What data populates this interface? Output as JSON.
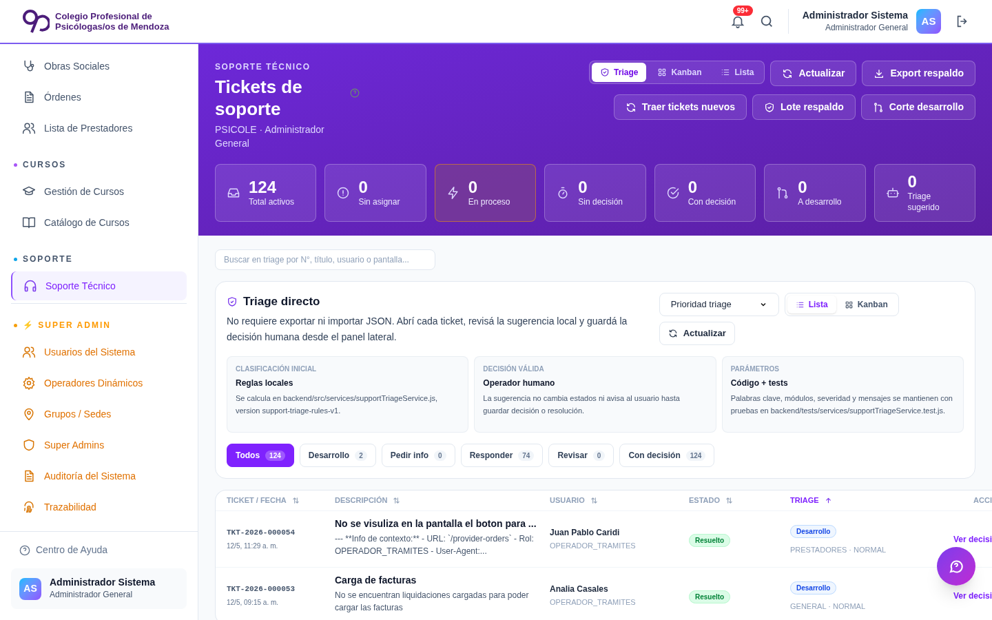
{
  "header": {
    "org_line_1": "Colegio Profesional de",
    "org_line_2": "Psicólogas/os de Mendoza",
    "notification_badge": "99+",
    "user_name": "Administrador Sistema",
    "user_role": "Administrador General",
    "avatar": "AS"
  },
  "sidebar": {
    "sections": [
      {
        "kind": "normal",
        "items": [
          {
            "label": "Obras Sociales",
            "selected": false
          },
          {
            "label": "Órdenes",
            "selected": false
          },
          {
            "label": "Lista de Prestadores",
            "selected": false
          }
        ]
      },
      {
        "label": "CURSOS",
        "color": "#a855f7",
        "kind": "normal",
        "items": [
          {
            "label": "Gestión de Cursos",
            "selected": false
          },
          {
            "label": "Catálogo de Cursos",
            "selected": false
          }
        ]
      },
      {
        "label": "SOPORTE",
        "color": "#0ea5e9",
        "kind": "normal",
        "items": [
          {
            "label": "Soporte Técnico",
            "selected": true
          }
        ]
      },
      {
        "label": "⚡ SUPER ADMIN",
        "color": "#f59e0b",
        "kind": "admin",
        "items": [
          {
            "label": "Usuarios del Sistema",
            "selected": false
          },
          {
            "label": "Operadores Dinámicos",
            "selected": false
          },
          {
            "label": "Grupos / Sedes",
            "selected": false
          },
          {
            "label": "Super Admins",
            "selected": false
          },
          {
            "label": "Auditoría del Sistema",
            "selected": false
          },
          {
            "label": "Trazabilidad",
            "selected": false
          }
        ]
      }
    ],
    "help_link": "Centro de Ayuda",
    "user_name": "Administrador Sistema",
    "user_role": "Administrador General",
    "avatar": "AS"
  },
  "hero": {
    "eyebrow": "SOPORTE TÉCNICO",
    "title": "Tickets de soporte",
    "subtitle": "PSICOLE · Administrador General",
    "views": [
      {
        "label": "Triage",
        "selected": true
      },
      {
        "label": "Kanban",
        "selected": false
      },
      {
        "label": "Lista",
        "selected": false
      }
    ],
    "actions": [
      "Actualizar",
      "Export respaldo",
      "Traer tickets nuevos",
      "Lote respaldo",
      "Corte desarrollo"
    ],
    "stats": [
      {
        "value": "124",
        "label": "Total activos",
        "selected": false
      },
      {
        "value": "0",
        "label": "Sin asignar",
        "selected": false
      },
      {
        "value": "0",
        "label": "En proceso",
        "selected": true
      },
      {
        "value": "0",
        "label": "Sin decisión",
        "selected": false
      },
      {
        "value": "0",
        "label": "Con decisión",
        "selected": false
      },
      {
        "value": "0",
        "label": "A desarrollo",
        "selected": false
      },
      {
        "value": "0",
        "label": "Triage sugerido",
        "selected": false
      }
    ]
  },
  "search": {
    "placeholder": "Buscar en triage por N°, título, usuario o pantalla..."
  },
  "triage": {
    "title": "Triage directo",
    "description": "No requiere exportar ni importar JSON. Abrí cada ticket, revisá la sugerencia local y guardá la decisión humana desde el panel lateral.",
    "sort_select": "Prioridad triage",
    "layouts": [
      {
        "label": "Lista",
        "selected": true
      },
      {
        "label": "Kanban",
        "selected": false
      }
    ],
    "refresh": "Actualizar",
    "info_cards": [
      {
        "label": "CLASIFICACIÓN INICIAL",
        "title": "Reglas locales",
        "text": "Se calcula en backend/src/services/supportTriageService.js, version support-triage-rules-v1."
      },
      {
        "label": "DECISIÓN VÁLIDA",
        "title": "Operador humano",
        "text": "La sugerencia no cambia estados ni avisa al usuario hasta guardar decisión o resolución."
      },
      {
        "label": "PARÁMETROS",
        "title": "Código + tests",
        "text": "Palabras clave, módulos, severidad y mensajes se mantienen con pruebas en backend/tests/services/supportTriageService.test.js."
      }
    ],
    "filters": [
      {
        "label": "Todos",
        "count": "124",
        "selected": true
      },
      {
        "label": "Desarrollo",
        "count": "2",
        "selected": false
      },
      {
        "label": "Pedir info",
        "count": "0",
        "selected": false
      },
      {
        "label": "Responder",
        "count": "74",
        "selected": false
      },
      {
        "label": "Revisar",
        "count": "0",
        "selected": false
      },
      {
        "label": "Con decisión",
        "count": "124",
        "selected": false
      }
    ]
  },
  "table": {
    "columns": [
      {
        "label": "TICKET / FECHA",
        "sorted": false
      },
      {
        "label": "DESCRIPCIÓN",
        "sorted": false
      },
      {
        "label": "USUARIO",
        "sorted": false
      },
      {
        "label": "ESTADO",
        "sorted": false
      },
      {
        "label": "TRIAGE",
        "sorted": true
      },
      {
        "label": "ACCI"
      }
    ],
    "rows": [
      {
        "ticket": "TKT-2026-000054",
        "date": "12/5, 11:29 a. m.",
        "title": "No se visuliza en la pantalla el boton para ...",
        "description": "--- **Info de contexto:** - URL: `/provider-orders` - Rol: OPERADOR_TRAMITES - User-Agent:...",
        "user": "Juan Pablo Caridi",
        "role": "OPERADOR_TRAMITES",
        "status": "Resuelto",
        "triage": "Desarrollo",
        "triage_meta": "PRESTADORES · NORMAL",
        "action": "Ver decisi"
      },
      {
        "ticket": "TKT-2026-000053",
        "date": "12/5, 09:15 a. m.",
        "title": "Carga de facturas",
        "description": "No se encuentran liquidaciones cargadas para poder cargar las facturas",
        "user": "Analia Casales",
        "role": "OPERADOR_TRAMITES",
        "status": "Resuelto",
        "triage": "Desarrollo",
        "triage_meta": "GENERAL · NORMAL",
        "action": "Ver decisi"
      }
    ]
  }
}
